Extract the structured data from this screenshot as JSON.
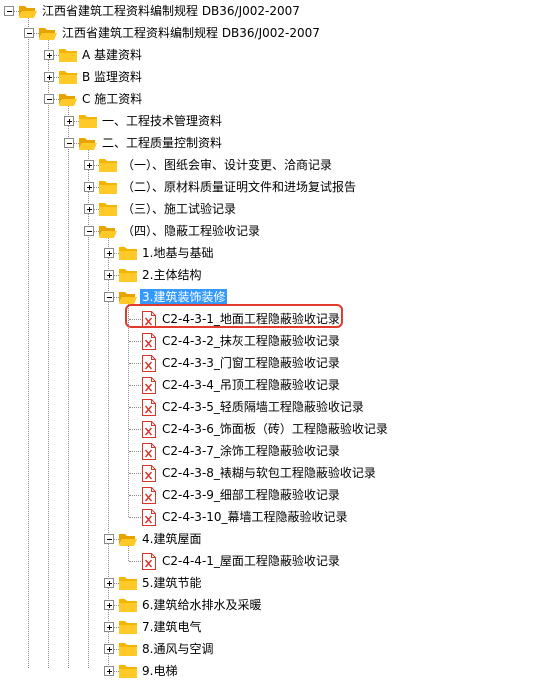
{
  "tree": {
    "root": {
      "label": "江西省建筑工程资料编制规程 DB36/J002-2007"
    },
    "level1": {
      "label": "江西省建筑工程资料编制规程 DB36/J002-2007"
    },
    "sections": [
      {
        "label": "A 基建资料"
      },
      {
        "label": "B 监理资料"
      },
      {
        "label": "C 施工资料"
      }
    ],
    "construction": [
      {
        "label": "一、工程技术管理资料"
      },
      {
        "label": "二、工程质量控制资料"
      }
    ],
    "quality": [
      {
        "label": "（一）、图纸会审、设计变更、洽商记录"
      },
      {
        "label": "（二）、原材料质量证明文件和进场复试报告"
      },
      {
        "label": "（三）、施工试验记录"
      },
      {
        "label": "（四）、隐蔽工程验收记录"
      }
    ],
    "hidden_work": [
      {
        "label": "1.地基与基础"
      },
      {
        "label": "2.主体结构"
      },
      {
        "label": "3.建筑装饰装修"
      }
    ],
    "decoration_files": [
      {
        "label": "C2-4-3-1_地面工程隐蔽验收记录"
      },
      {
        "label": "C2-4-3-2_抹灰工程隐蔽验收记录"
      },
      {
        "label": "C2-4-3-3_门窗工程隐蔽验收记录"
      },
      {
        "label": "C2-4-3-4_吊顶工程隐蔽验收记录"
      },
      {
        "label": "C2-4-3-5_轻质隔墙工程隐蔽验收记录"
      },
      {
        "label": "C2-4-3-6_饰面板（砖）工程隐蔽验收记录"
      },
      {
        "label": "C2-4-3-7_涂饰工程隐蔽验收记录"
      },
      {
        "label": "C2-4-3-8_裱糊与软包工程隐蔽验收记录"
      },
      {
        "label": "C2-4-3-9_细部工程隐蔽验收记录"
      },
      {
        "label": "C2-4-3-10_幕墙工程隐蔽验收记录"
      }
    ],
    "roof": {
      "label": "4.建筑屋面"
    },
    "roof_files": [
      {
        "label": "C2-4-4-1_屋面工程隐蔽验收记录"
      }
    ],
    "others": [
      {
        "label": "5.建筑节能"
      },
      {
        "label": "6.建筑给水排水及采暖"
      },
      {
        "label": "7.建筑电气"
      },
      {
        "label": "8.通风与空调"
      },
      {
        "label": "9.电梯"
      }
    ]
  },
  "colors": {
    "folder": "#f5b400",
    "selection": "#3399ff",
    "highlight_ring": "#e03b2c",
    "doc_icon": "#d9352b"
  },
  "icons": {
    "folder": "folder-icon",
    "document": "doc-x-icon"
  }
}
